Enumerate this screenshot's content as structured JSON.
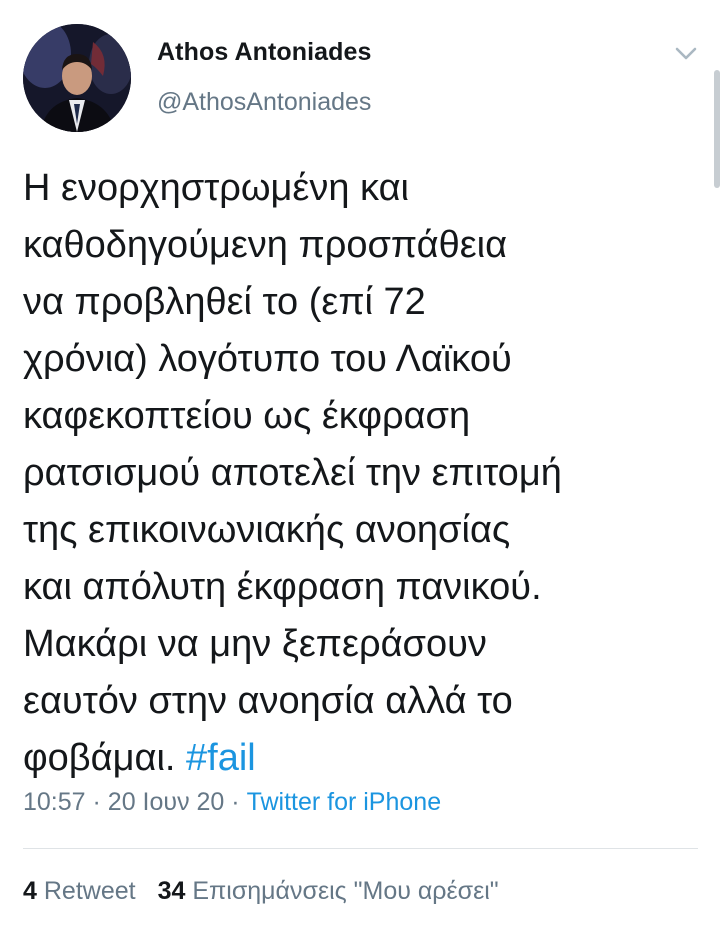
{
  "author": {
    "display_name": "Athos Antoniades",
    "handle": "@AthosAntoniades"
  },
  "tweet": {
    "lines": [
      "Η ενορχηστρωμένη και",
      "καθοδηγούμενη προσπάθεια",
      "να προβληθεί το (επί 72",
      "χρόνια) λογότυπο του  Λαϊκού",
      "καφεκοπτείου ως έκφραση",
      "ρατσισμού αποτελεί την επιτομή",
      "της επικοινωνιακής ανοησίας",
      "και απόλυτη έκφραση πανικού.",
      "Μακάρι να μην ξεπεράσουν",
      "εαυτόν στην ανοησία αλλά το"
    ],
    "last_line_text": "φοβάμαι.",
    "hashtag": "#fail"
  },
  "meta": {
    "time": "10:57",
    "separator": "·",
    "date": "20 Ιουν 20",
    "source": "Twitter for iPhone"
  },
  "stats": {
    "retweets_count": "4",
    "retweets_label": "Retweet",
    "likes_count": "34",
    "likes_label": "Επισημάνσεις \"Μου αρέσει\""
  },
  "icons": {
    "menu": "chevron-down-icon"
  },
  "colors": {
    "link": "#1b95e0",
    "secondary_text": "#657786",
    "primary_text": "#14171a"
  }
}
